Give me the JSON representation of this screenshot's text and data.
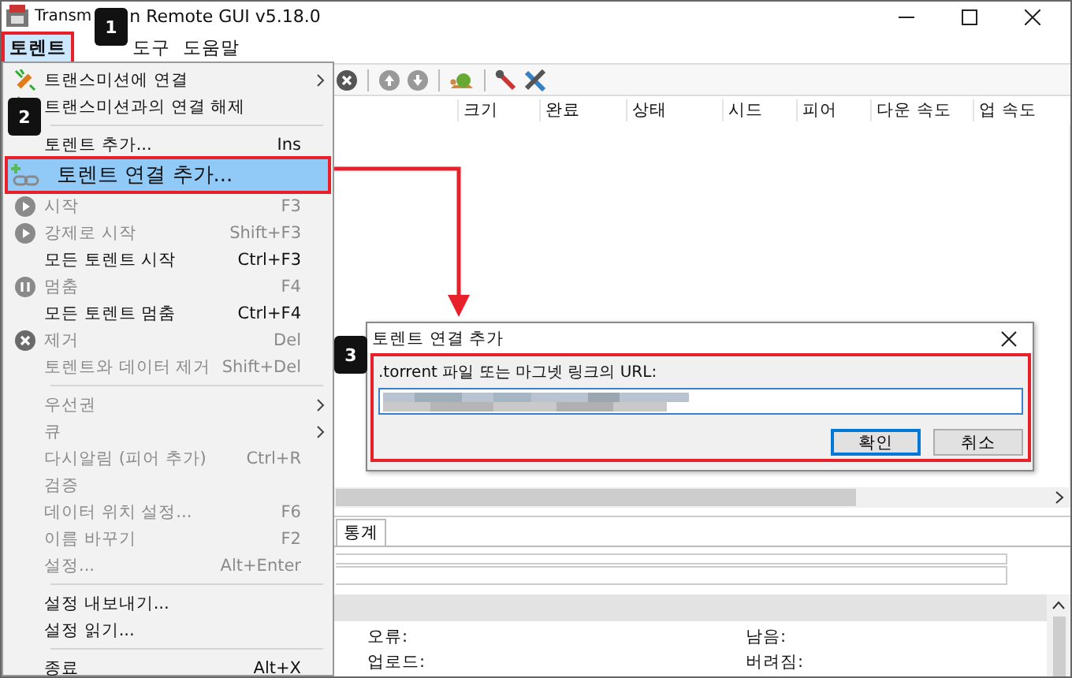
{
  "window": {
    "title_visible": [
      "Transm",
      "n Remote GUI v5.18.0"
    ]
  },
  "menubar": [
    {
      "label": "토렌트",
      "selected": true
    },
    {
      "label": "도구",
      "selected": false
    },
    {
      "label": "도움말",
      "selected": false
    }
  ],
  "menu": {
    "sections": [
      [
        {
          "label": "트랜스미션에 연결",
          "kind": "connect",
          "disabled": false,
          "selected": false,
          "submenu": true
        },
        {
          "label": "트랜스미션과의 연결 해제",
          "kind": "disconnect",
          "disabled": false,
          "selected": false,
          "submenu": false
        }
      ],
      [
        {
          "label": "토렌트 추가...",
          "shortcut": "Ins",
          "kind": "plain",
          "disabled": false,
          "selected": false,
          "submenu": false
        },
        {
          "label": "토렌트 연결 추가...",
          "kind": "add-link",
          "disabled": false,
          "selected": true,
          "submenu": false
        },
        {
          "label": "시작",
          "shortcut": "F3",
          "kind": "start",
          "disabled": true,
          "selected": false,
          "submenu": false
        },
        {
          "label": "강제로 시작",
          "shortcut": "Shift+F3",
          "kind": "start",
          "disabled": true,
          "selected": false,
          "submenu": false
        },
        {
          "label": "모든 토렌트 시작",
          "shortcut": "Ctrl+F3",
          "kind": "plain",
          "disabled": false,
          "selected": false,
          "submenu": false
        },
        {
          "label": "멈춤",
          "shortcut": "F4",
          "kind": "pause",
          "disabled": true,
          "selected": false,
          "submenu": false
        },
        {
          "label": "모든 토렌트 멈춤",
          "shortcut": "Ctrl+F4",
          "kind": "plain",
          "disabled": false,
          "selected": false,
          "submenu": false
        },
        {
          "label": "제거",
          "shortcut": "Del",
          "kind": "remove",
          "disabled": true,
          "selected": false,
          "submenu": false
        },
        {
          "label": "토렌트와 데이터 제거",
          "shortcut": "Shift+Del",
          "kind": "plain",
          "disabled": true,
          "selected": false,
          "submenu": false
        }
      ],
      [
        {
          "label": "우선권",
          "kind": "plain",
          "disabled": true,
          "selected": false,
          "submenu": true
        },
        {
          "label": "큐",
          "kind": "plain",
          "disabled": true,
          "selected": false,
          "submenu": true
        },
        {
          "label": "다시알림 (피어 추가)",
          "shortcut": "Ctrl+R",
          "kind": "plain",
          "disabled": true,
          "selected": false,
          "submenu": false
        },
        {
          "label": "검증",
          "kind": "plain",
          "disabled": true,
          "selected": false,
          "submenu": false
        },
        {
          "label": "데이터 위치 설정...",
          "shortcut": "F6",
          "kind": "plain",
          "disabled": true,
          "selected": false,
          "submenu": false
        },
        {
          "label": "이름 바꾸기",
          "shortcut": "F2",
          "kind": "plain",
          "disabled": true,
          "selected": false,
          "submenu": false
        },
        {
          "label": "설정...",
          "shortcut": "Alt+Enter",
          "kind": "plain",
          "disabled": true,
          "selected": false,
          "submenu": false
        }
      ],
      [
        {
          "label": "설정 내보내기...",
          "kind": "plain",
          "disabled": false,
          "selected": false,
          "submenu": false
        },
        {
          "label": "설정 읽기...",
          "kind": "plain",
          "disabled": false,
          "selected": false,
          "submenu": false
        }
      ],
      [
        {
          "label": "종료",
          "shortcut": "Alt+X",
          "kind": "plain",
          "disabled": false,
          "selected": false,
          "submenu": false
        }
      ]
    ]
  },
  "table": {
    "columns": [
      "크기",
      "완료",
      "상태",
      "시드",
      "피어",
      "다운 속도",
      "업 속도"
    ]
  },
  "tabs": [
    {
      "label": "통계",
      "selected": true
    }
  ],
  "info": {
    "fields": [
      "오류:",
      "남음:",
      "업로드:",
      "버려짐:"
    ]
  },
  "dialog": {
    "title": "토렌트 연결 추가",
    "label": ".torrent 파일 또는 마그넷 링크의 URL:",
    "buttons": [
      {
        "label": "확인",
        "default": true
      },
      {
        "label": "취소",
        "default": false
      }
    ]
  },
  "annotations": [
    {
      "label": "1"
    },
    {
      "label": "2"
    },
    {
      "label": "3"
    }
  ]
}
